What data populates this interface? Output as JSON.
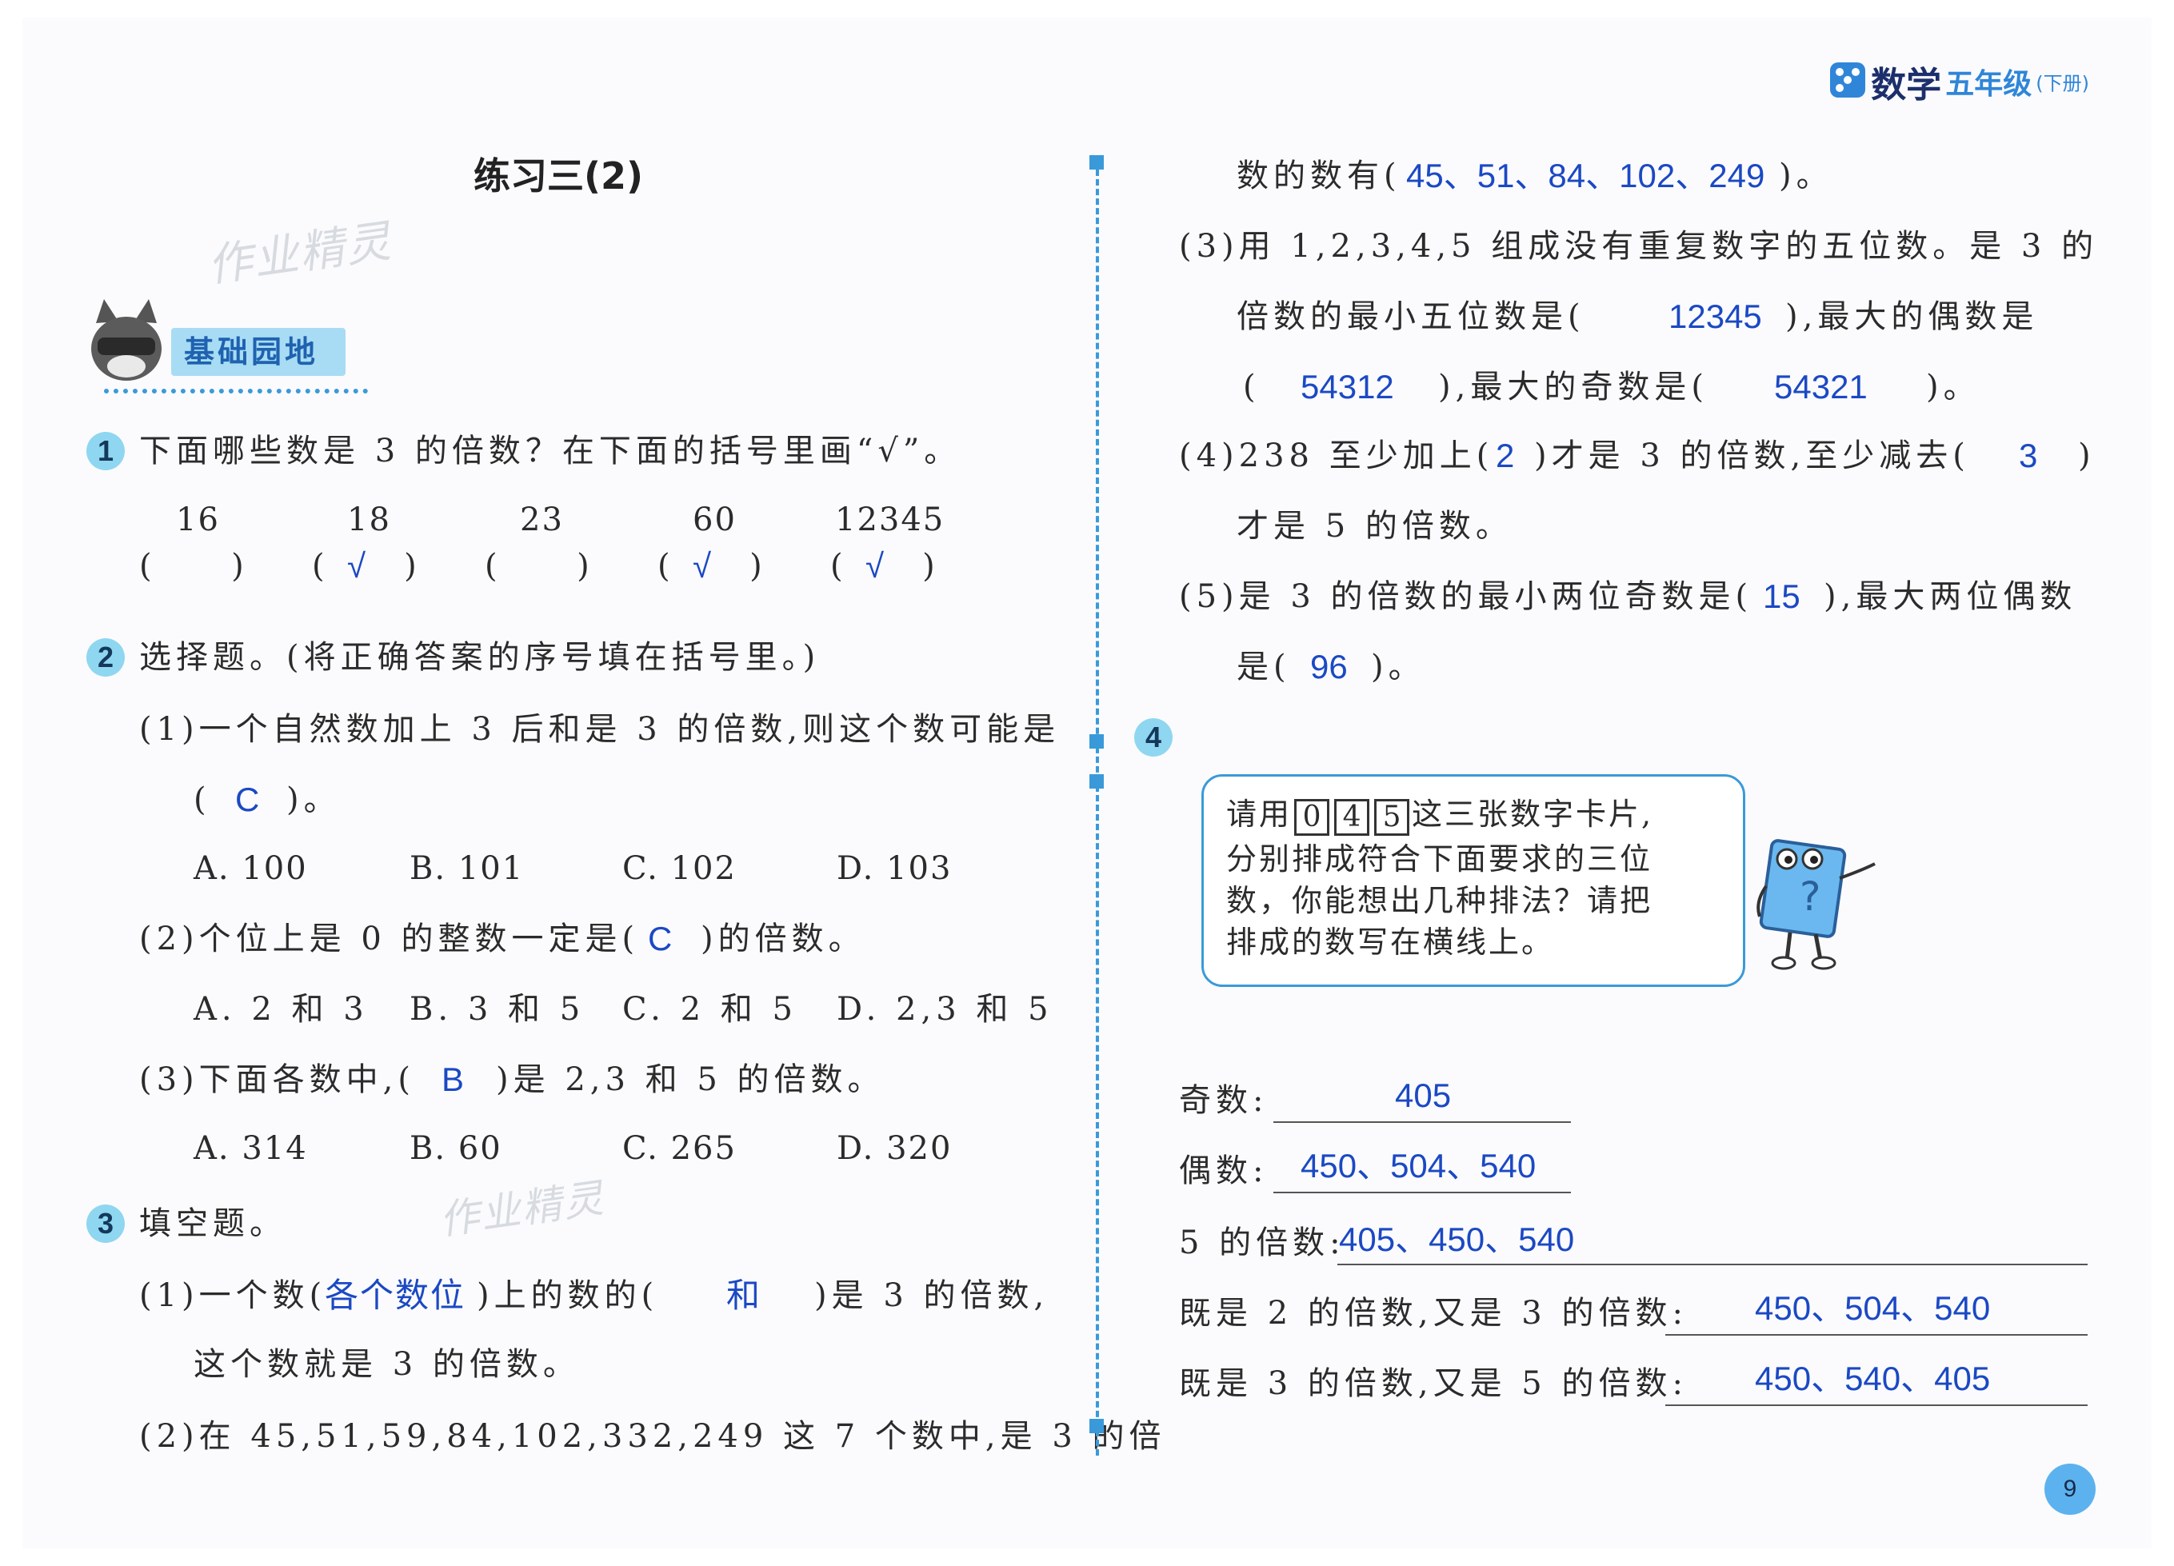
{
  "header": {
    "subject": "数学",
    "grade": "五年级",
    "volume": "(下册)"
  },
  "page_title": "练习三(2)",
  "watermark": "作业精灵",
  "section_banner": "基础园地",
  "page_number": "9",
  "q1": {
    "number": "1",
    "prompt": "下面哪些数是 3 的倍数？在下面的括号里画“√”。",
    "items": [
      {
        "value": "16",
        "mark": ""
      },
      {
        "value": "18",
        "mark": "√"
      },
      {
        "value": "23",
        "mark": ""
      },
      {
        "value": "60",
        "mark": "√"
      },
      {
        "value": "12345",
        "mark": "√"
      }
    ]
  },
  "q2": {
    "number": "2",
    "prompt": "选择题。(将正确答案的序号填在括号里。)",
    "p1": {
      "text": "(1)一个自然数加上 3 后和是 3 的倍数,则这个数可能是",
      "ans_pre": "(",
      "answer": "C",
      "ans_post": ")。",
      "options": [
        "A. 100",
        "B. 101",
        "C. 102",
        "D. 103"
      ]
    },
    "p2": {
      "pre": "(2)个位上是 0 的整数一定是(",
      "answer": "C",
      "post": ")的倍数。",
      "options": [
        "A. 2 和 3",
        "B. 3 和 5",
        "C. 2 和 5",
        "D. 2,3 和 5"
      ]
    },
    "p3": {
      "pre": "(3)下面各数中,(",
      "answer": "B",
      "post": ")是 2,3 和 5 的倍数。",
      "options": [
        "A. 314",
        "B. 60",
        "C. 265",
        "D. 320"
      ]
    }
  },
  "q3": {
    "number": "3",
    "prompt": "填空题。",
    "p1": {
      "pre": "(1)一个数(",
      "answer_a": "各个数位",
      "mid": ")上的数的(",
      "answer_b": "和",
      "post": ")是 3 的倍数,",
      "line2": "这个数就是 3 的倍数。"
    },
    "p2": {
      "line1": "(2)在 45,51,59,84,102,332,249 这 7 个数中,是 3 的倍",
      "line2_pre": "数的数有(",
      "answer": "45、51、84、102、249",
      "line2_post": ")。"
    },
    "p3": {
      "line1": "(3)用 1,2,3,4,5 组成没有重复数字的五位数。是 3 的",
      "line2_pre": "倍数的最小五位数是(",
      "answer_min": "12345",
      "line2_post": "),最大的偶数是",
      "line3_pre": "(",
      "answer_even": "54312",
      "line3_mid": "),最大的奇数是(",
      "answer_odd": "54321",
      "line3_post": ")。"
    },
    "p4": {
      "pre": "(4)238 至少加上(",
      "answer_add": "2",
      "mid": ")才是 3 的倍数,至少减去(",
      "answer_sub": "3",
      "post": ")",
      "line2": "才是 5 的倍数。"
    },
    "p5": {
      "pre": "(5)是 3 的倍数的最小两位奇数是(",
      "answer_odd": "15",
      "post": "),最大两位偶数",
      "line2_pre": "是(",
      "answer_even": "96",
      "line2_post": ")。"
    }
  },
  "q4": {
    "number": "4",
    "bubble_line1_pre": "请用",
    "cards": [
      "0",
      "4",
      "5"
    ],
    "bubble_line1_post": "这三张数字卡片,",
    "bubble_line2": "分别排成符合下面要求的三位",
    "bubble_line3": "数，你能想出几种排法？请把",
    "bubble_line4": "排成的数写在横线上。",
    "rows": [
      {
        "label": "奇数:",
        "answer": "405"
      },
      {
        "label": "偶数:",
        "answer": "450、504、540"
      },
      {
        "label": "5 的倍数:",
        "answer": "405、450、540"
      },
      {
        "label": "既是 2 的倍数,又是 3 的倍数:",
        "answer": "450、504、540"
      },
      {
        "label": "既是 3 的倍数,又是 5 的倍数:",
        "answer": "450、540、405"
      }
    ]
  },
  "colors": {
    "accent_blue": "#1b49c4",
    "badge": "#8fd6f1",
    "divider": "#3a9ad9",
    "banner": "#a8dcf4"
  }
}
